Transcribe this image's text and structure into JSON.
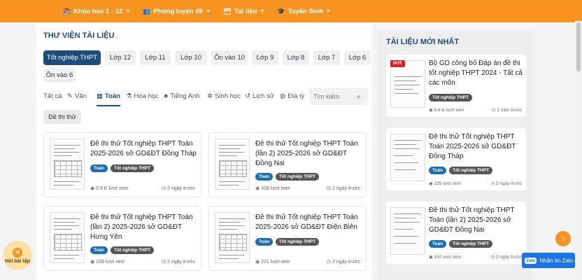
{
  "nav": {
    "items": [
      {
        "label": "Khóa học 1 - 12",
        "icon": "book-icon"
      },
      {
        "label": "Phòng luyện đề",
        "icon": "users-icon"
      },
      {
        "label": "Tài liệu",
        "icon": "folder-icon"
      },
      {
        "label": "Tuyển Sinh",
        "icon": "graduation-icon"
      }
    ]
  },
  "library": {
    "title": "THƯ VIỆN TÀI LIỆU",
    "levels": [
      "Tốt nghiệp THPT",
      "Lớp 12",
      "Lớp 11",
      "Lớp 10",
      "Ôn vào 10",
      "Lớp 9",
      "Lớp 8",
      "Lớp 7",
      "Lớp 6",
      "Ôn vào 6"
    ],
    "subjects": [
      "Tất cả",
      "Văn",
      "Toán",
      "Hóa học",
      "Tiếng Anh",
      "Sinh học",
      "Lịch sử",
      "Địa lý"
    ],
    "active_subject": "Toán",
    "search_placeholder": "Tìm kiếm",
    "subfilter": "Đề thi thử",
    "cards": [
      {
        "title": "Đề thi thử Tốt nghiệp THPT Toán 2025-2026 sở GD&ĐT Đồng Tháp",
        "tags": [
          "Toán",
          "Tốt nghiệp THPT"
        ],
        "views": "0.9 K lượt xem",
        "time": "2 ngày trước"
      },
      {
        "title": "Đề thi thử Tốt nghiệp THPT Toán (lần 2) 2025-2026 sở GD&ĐT Đồng Nai",
        "tags": [
          "Toán",
          "Tốt nghiệp THPT"
        ],
        "views": "318 lượt xem",
        "time": "2 ngày trước"
      },
      {
        "title": "Đề thi thử Tốt nghiệp THPT Toán (lần 2) 2025-2026 sở GD&ĐT Hưng Yên",
        "tags": [
          "Toán",
          "Tốt nghiệp THPT"
        ],
        "views": "239 lượt xem",
        "time": "2 ngày trước"
      },
      {
        "title": "Đề thi thử Tốt nghiệp THPT Toán 2025-2026 sở GD&ĐT Điện Biên",
        "tags": [
          "Toán",
          "Tốt nghiệp THPT"
        ],
        "views": "221 lượt xem",
        "time": "2 ngày trước"
      }
    ]
  },
  "latest": {
    "title": "TÀI LIỆU MỚI NHẤT",
    "hot_badge": "HOT",
    "items": [
      {
        "title": "Bộ GD công bố Đáp án đề thi tốt nghiệp THPT 2024 - Tất cả các môn",
        "tags": [
          "Tốt nghiệp THPT"
        ],
        "views": "5.4 K lượt xem",
        "time": "1 năm trước"
      },
      {
        "title": "Đề thi thử Tốt nghiệp THPT Toán 2025-2026 sở GD&ĐT Đồng Tháp",
        "tags": [
          "Toán",
          "Tốt nghiệp THPT"
        ],
        "views": "335 lượt xem",
        "time": "2 ngày trước"
      },
      {
        "title": "Đề thi thử Tốt nghiệp THPT Toán (lần 2) 2025-2026 sở GD&ĐT Đồng Nai",
        "tags": [
          "Toán",
          "Tốt nghiệp THPT"
        ],
        "views": "150 lượt xem",
        "time": "2 ngày trước"
      }
    ]
  },
  "widgets": {
    "hoi_label": "Hỏi bài tập",
    "hoi_icon_letter": "H",
    "zalo_logo": "Zalo",
    "zalo_label": "Nhắn tin Zalo"
  },
  "colors": {
    "brand_orange": "#f7931e",
    "brand_navy": "#1c4c7a",
    "tag_blue": "#1c6fb3",
    "hot_red": "#d92027"
  }
}
